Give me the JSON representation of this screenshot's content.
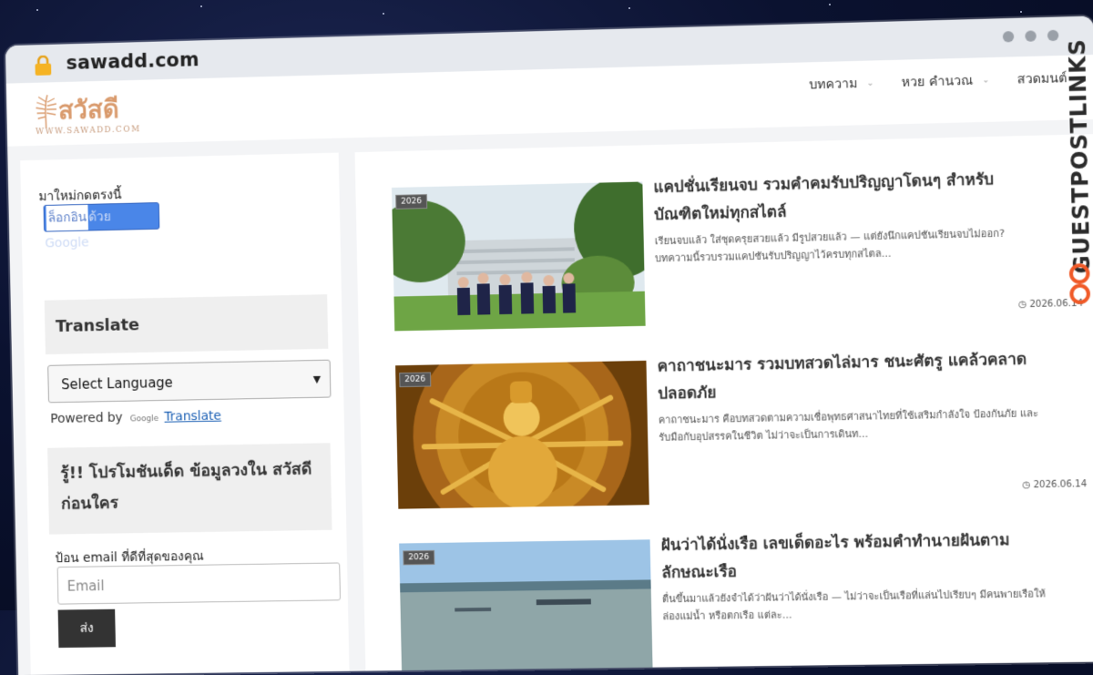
{
  "browser": {
    "url": "sawadd.com"
  },
  "site": {
    "logo_text": "สวัสดี",
    "logo_sub": "WWW.SAWADD.COM",
    "nav": [
      {
        "label": "บทความ"
      },
      {
        "label": "หวย คำนวณ"
      },
      {
        "label": "สวดมนต์"
      }
    ]
  },
  "sidebar": {
    "new_prompt": "มาใหม่กดตรงนี้",
    "google_login_highlight": "ล็อกอิน",
    "google_login_rest": "ด้วย Google",
    "translate_title": "Translate",
    "select_language": "Select Language",
    "powered_by": "Powered by",
    "google_mini": "Google",
    "translate_link": "Translate",
    "promo_title": "รู้!! โปรโมชันเด็ด ข้อมูลวงใน สวัสดี ก่อนใคร",
    "email_label": "ป้อน email ที่ดีที่สุดของคุณ",
    "email_placeholder": "Email",
    "submit_label": "ส่ง"
  },
  "posts": [
    {
      "badge": "2026",
      "title": "แคปชั่นเรียนจบ รวมคำคมรับปริญญาโดนๆ สำหรับบัณฑิตใหม่ทุกสไตล์",
      "excerpt": "เรียนจบแล้ว ใส่ชุดครุยสวยแล้ว มีรูปสวยแล้ว — แต่ยังนึกแคปชันเรียนจบไม่ออก? บทความนี้รวบรวมแคปชันรับปริญญาไว้ครบทุกสไตล...",
      "date": "2026.06.14"
    },
    {
      "badge": "2026",
      "title": "คาถาชนะมาร รวมบทสวดไล่มาร ชนะศัตรู แคล้วคลาดปลอดภัย",
      "excerpt": "คาถาชนะมาร คือบทสวดตามความเชื่อพุทธศาสนาไทยที่ใช้เสริมกำลังใจ ป้องกันภัย และรับมือกับอุปสรรคในชีวิต ไม่ว่าจะเป็นการเดินท...",
      "date": "2026.06.14"
    },
    {
      "badge": "2026",
      "title": "ฝันว่าได้นั่งเรือ เลขเด็ดอะไร พร้อมคำทำนายฝันตามลักษณะเรือ",
      "excerpt": "ตื่นขึ้นมาแล้วยังจำได้ว่าฝันว่าได้นั่งเรือ — ไม่ว่าจะเป็นเรือที่แล่นไปเรียบๆ มีคนพายเรือให้ ล่องแม่น้ำ หรือตกเรือ แต่ละ...",
      "date": ""
    }
  ],
  "watermark": {
    "text": "GUESTPOSTLINKS"
  },
  "colors": {
    "logo": "#d99a6c",
    "google_button": "#4a86e8",
    "watermark_accent": "#f05a28"
  }
}
